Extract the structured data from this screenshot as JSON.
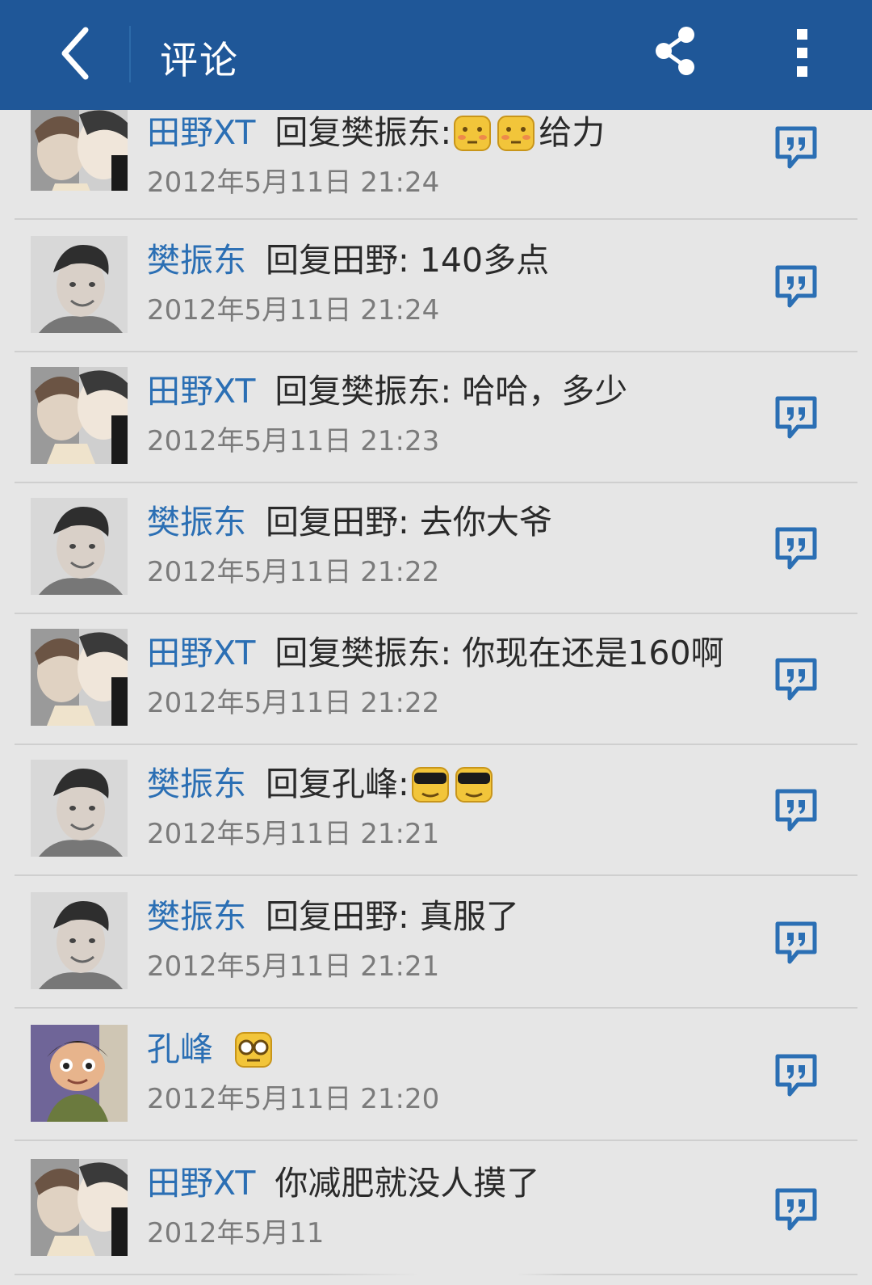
{
  "header": {
    "title": "评论",
    "back_icon": "chevron-left-icon",
    "share_icon": "share-icon",
    "more_icon": "more-vertical-icon",
    "bg_color": "#1f5798"
  },
  "colors": {
    "name": "#2b6fb4",
    "reply_icon": "#2b6fb4",
    "time": "#7b7b7b"
  },
  "comments": [
    {
      "name": "田野XT",
      "text": "回复樊振东: ",
      "emojis": [
        "blush-emoji",
        "blush-emoji"
      ],
      "after": "给力",
      "time": "2012年5月11日 21:24",
      "avatar": "tianye"
    },
    {
      "name": "樊振东",
      "text": "回复田野: 140多点",
      "time": "2012年5月11日 21:24",
      "avatar": "fanzhendong"
    },
    {
      "name": "田野XT",
      "text": "回复樊振东: 哈哈，多少",
      "time": "2012年5月11日 21:23",
      "avatar": "tianye"
    },
    {
      "name": "樊振东",
      "text": "回复田野: 去你大爷",
      "time": "2012年5月11日 21:22",
      "avatar": "fanzhendong"
    },
    {
      "name": "田野XT",
      "text": "回复樊振东: 你现在还是160啊",
      "time": "2012年5月11日 21:22",
      "avatar": "tianye"
    },
    {
      "name": "樊振东",
      "text": "回复孔峰: ",
      "emojis": [
        "sunglasses-emoji",
        "sunglasses-emoji"
      ],
      "time": "2012年5月11日 21:21",
      "avatar": "fanzhendong"
    },
    {
      "name": "樊振东",
      "text": "回复田野: 真服了",
      "time": "2012年5月11日 21:21",
      "avatar": "fanzhendong"
    },
    {
      "name": "孔峰",
      "text": "",
      "emojis": [
        "glasses-emoji"
      ],
      "time": "2012年5月11日 21:20",
      "avatar": "kongfeng"
    },
    {
      "name": "田野XT",
      "text": "你减肥就没人摸了",
      "time": "2012年5月11",
      "avatar": "tianye"
    }
  ]
}
